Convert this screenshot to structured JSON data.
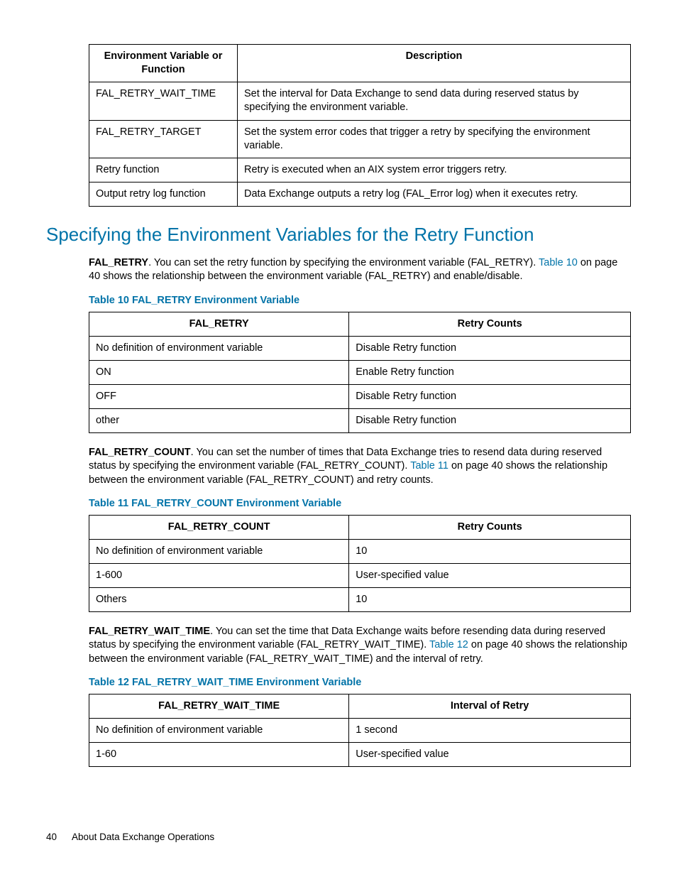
{
  "table1": {
    "headers": [
      "Environment Variable or Function",
      "Description"
    ],
    "rows": [
      [
        "FAL_RETRY_WAIT_TIME",
        "Set the interval for Data Exchange to send data during reserved status by specifying the environment variable."
      ],
      [
        "FAL_RETRY_TARGET",
        "Set the system error codes that trigger a retry by specifying the environment variable."
      ],
      [
        "Retry function",
        "Retry is executed when an AIX system error triggers retry."
      ],
      [
        "Output retry log function",
        "Data Exchange outputs a retry log (FAL_Error log) when it executes retry."
      ]
    ]
  },
  "section_heading": "Specifying the Environment Variables for the Retry Function",
  "para1": {
    "lead": "FAL_RETRY",
    "before_link": ". You can set the retry function by specifying the environment variable (FAL_RETRY). ",
    "link": "Table 10",
    "after_link": " on page 40 shows the relationship between the environment variable (FAL_RETRY) and enable/disable."
  },
  "caption10": "Table 10 FAL_RETRY Environment Variable",
  "table10": {
    "headers": [
      "FAL_RETRY",
      "Retry Counts"
    ],
    "rows": [
      [
        "No definition of environment variable",
        "Disable Retry function"
      ],
      [
        "ON",
        "Enable Retry function"
      ],
      [
        "OFF",
        "Disable Retry function"
      ],
      [
        "other",
        "Disable Retry function"
      ]
    ]
  },
  "para2": {
    "lead": "FAL_RETRY_COUNT",
    "before_link": ". You can set the number of times that Data Exchange tries to resend data during reserved status by specifying the environment variable (FAL_RETRY_COUNT). ",
    "link": "Table 11",
    "after_link": " on page 40 shows the relationship between the environment variable (FAL_RETRY_COUNT) and retry counts."
  },
  "caption11": "Table 11 FAL_RETRY_COUNT Environment Variable",
  "table11": {
    "headers": [
      "FAL_RETRY_COUNT",
      "Retry Counts"
    ],
    "rows": [
      [
        "No definition of environment variable",
        "10"
      ],
      [
        "1-600",
        "User-specified value"
      ],
      [
        "Others",
        "10"
      ]
    ]
  },
  "para3": {
    "lead": "FAL_RETRY_WAIT_TIME",
    "before_link": ". You can set the time that Data Exchange waits before resending data during reserved status by specifying the environment variable (FAL_RETRY_WAIT_TIME). ",
    "link": "Table 12",
    "after_link": " on page 40 shows the relationship between the environment variable (FAL_RETRY_WAIT_TIME) and the interval of retry."
  },
  "caption12": "Table 12 FAL_RETRY_WAIT_TIME Environment Variable",
  "table12": {
    "headers": [
      "FAL_RETRY_WAIT_TIME",
      "Interval of Retry"
    ],
    "rows": [
      [
        "No definition of environment variable",
        "1 second"
      ],
      [
        "1-60",
        "User-specified value"
      ]
    ]
  },
  "footer": {
    "page": "40",
    "title": "About Data Exchange Operations"
  }
}
